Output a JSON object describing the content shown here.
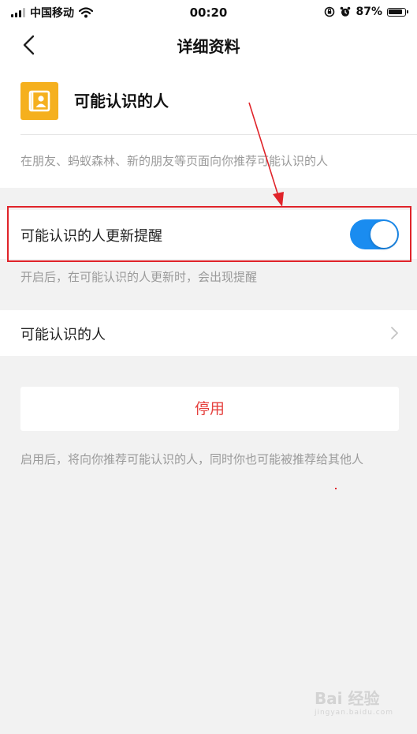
{
  "status_bar": {
    "carrier": "中国移动",
    "time": "00:20",
    "battery_percent": "87%",
    "battery_level": 0.87
  },
  "nav": {
    "title": "详细资料",
    "back_icon": "chevron-left-icon"
  },
  "feature": {
    "icon": "contacts-icon",
    "icon_color": "#f5b01e",
    "name": "可能认识的人",
    "description": "在朋友、蚂蚁森林、新的朋友等页面向你推荐可能认识的人"
  },
  "update_reminder": {
    "label": "可能认识的人更新提醒",
    "enabled": true,
    "hint": "开启后，在可能认识的人更新时，会出现提醒"
  },
  "people_row": {
    "label": "可能认识的人",
    "icon": "chevron-right-icon"
  },
  "stop_button": {
    "label": "停用",
    "color": "#e5403d"
  },
  "note": "启用后，将向你推荐可能认识的人，同时你也可能被推荐给其他人",
  "watermark": {
    "brand": "Bai 经验",
    "url": "jingyan.baidu.com"
  },
  "colors": {
    "toggle_on": "#1a8cf0",
    "annotation_red": "#e0242a"
  }
}
